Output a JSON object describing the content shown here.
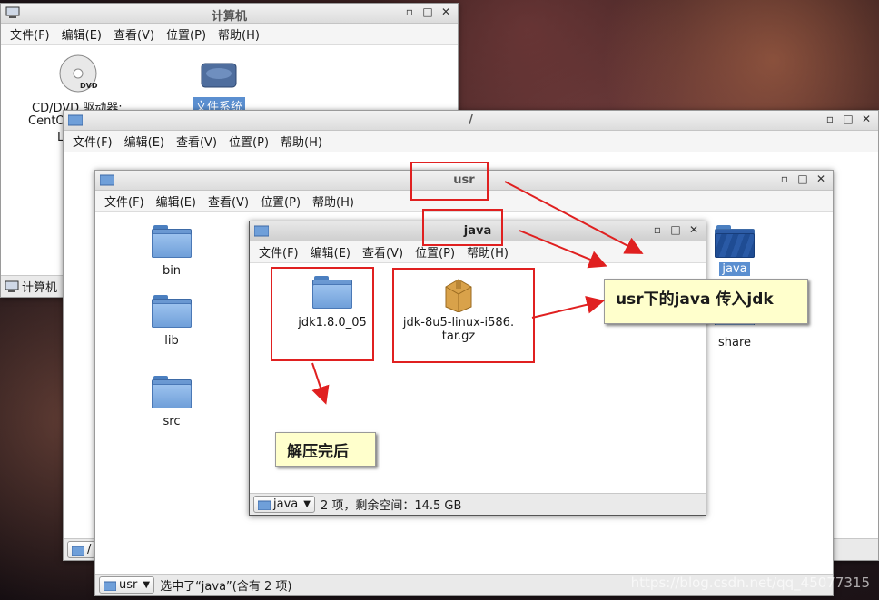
{
  "menu": [
    "文件(F)",
    "编辑(E)",
    "查看(V)",
    "位置(P)",
    "帮助(H)"
  ],
  "win_computer": {
    "title": "计算机",
    "items": [
      {
        "label": "CD/DVD 驱动器:",
        "label2": "CentO",
        "label3": "L"
      },
      {
        "label": "文件系统"
      }
    ],
    "taskbar_label": "计算机"
  },
  "win_root": {
    "title": "/",
    "path": "/"
  },
  "win_usr": {
    "title": "usr",
    "items": [
      {
        "label": "bin"
      },
      {
        "label": "lib"
      },
      {
        "label": "src"
      },
      {
        "label": "java"
      },
      {
        "label": "share"
      }
    ],
    "path": "usr",
    "status": "选中了“java”(含有 2 项)"
  },
  "win_java": {
    "title": "java",
    "items": [
      {
        "label": "jdk1.8.0_05"
      },
      {
        "label": "jdk-8u5-linux-i586.",
        "label2": "tar.gz"
      }
    ],
    "path": "java",
    "status": "2 项，剩余空间：14.5 GB"
  },
  "annotations": {
    "callout1": "usr下的java 传入jdk",
    "callout2": "解压完后"
  },
  "window_controls": {
    "min": "▫",
    "max": "□",
    "close": "✕"
  },
  "watermark": "https://blog.csdn.net/qq_45077315",
  "colors": {
    "annotation_red": "#e02020",
    "callout_bg": "#ffffcc",
    "folder_blue": "#6f9fd9",
    "selection": "#5b8fd0"
  }
}
